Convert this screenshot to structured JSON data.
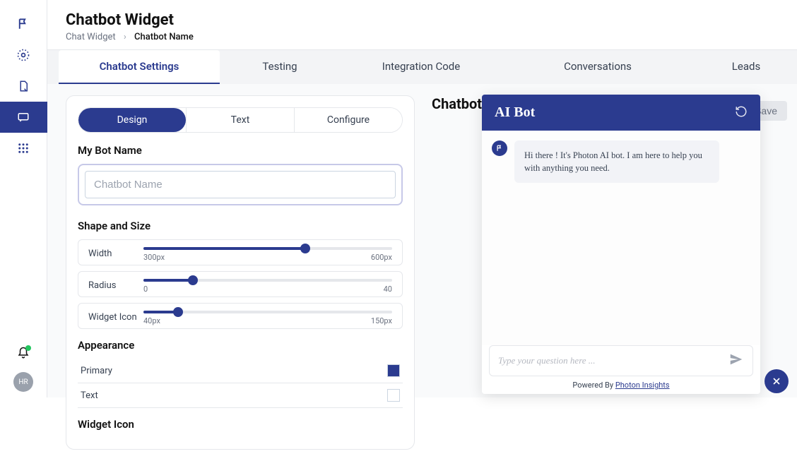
{
  "colors": {
    "primary": "#2b3b8f",
    "text": "#ffffff"
  },
  "header": {
    "title": "Chatbot Widget",
    "breadcrumb": {
      "root": "Chat Widget",
      "current": "Chatbot Name"
    },
    "save_label": "Save"
  },
  "tabs": {
    "items": [
      {
        "label": "Chatbot Settings"
      },
      {
        "label": "Testing"
      },
      {
        "label": "Integration Code"
      },
      {
        "label": "Conversations"
      },
      {
        "label": "Leads"
      }
    ],
    "active": 0
  },
  "subtabs": {
    "items": [
      {
        "label": "Design"
      },
      {
        "label": "Text"
      },
      {
        "label": "Configure"
      }
    ],
    "active": 0
  },
  "sections": {
    "bot_name": {
      "label": "My Bot Name",
      "placeholder": "Chatbot Name",
      "value": ""
    },
    "shape_size": {
      "label": "Shape and Size",
      "sliders": [
        {
          "name": "Width",
          "min_label": "300px",
          "max_label": "600px",
          "pct": 65
        },
        {
          "name": "Radius",
          "min_label": "0",
          "max_label": "40",
          "pct": 20
        },
        {
          "name": "Widget Icon",
          "min_label": "40px",
          "max_label": "150px",
          "pct": 14
        }
      ]
    },
    "appearance": {
      "label": "Appearance",
      "rows": [
        {
          "label": "Primary",
          "color": "#2b3b8f"
        },
        {
          "label": "Text",
          "color": "#ffffff"
        }
      ]
    },
    "widget_icon": {
      "label": "Widget Icon"
    }
  },
  "preview": {
    "title": "Chatbot Preview",
    "chat": {
      "header_title": "AI Bot",
      "welcome": "Hi there ! It's Photon AI bot. I am here to help you with anything you need.",
      "input_placeholder": "Type your question here ...",
      "powered_prefix": "Powered By ",
      "powered_link": "Photon Insights"
    }
  },
  "sidebar": {
    "avatar_initials": "HR"
  }
}
